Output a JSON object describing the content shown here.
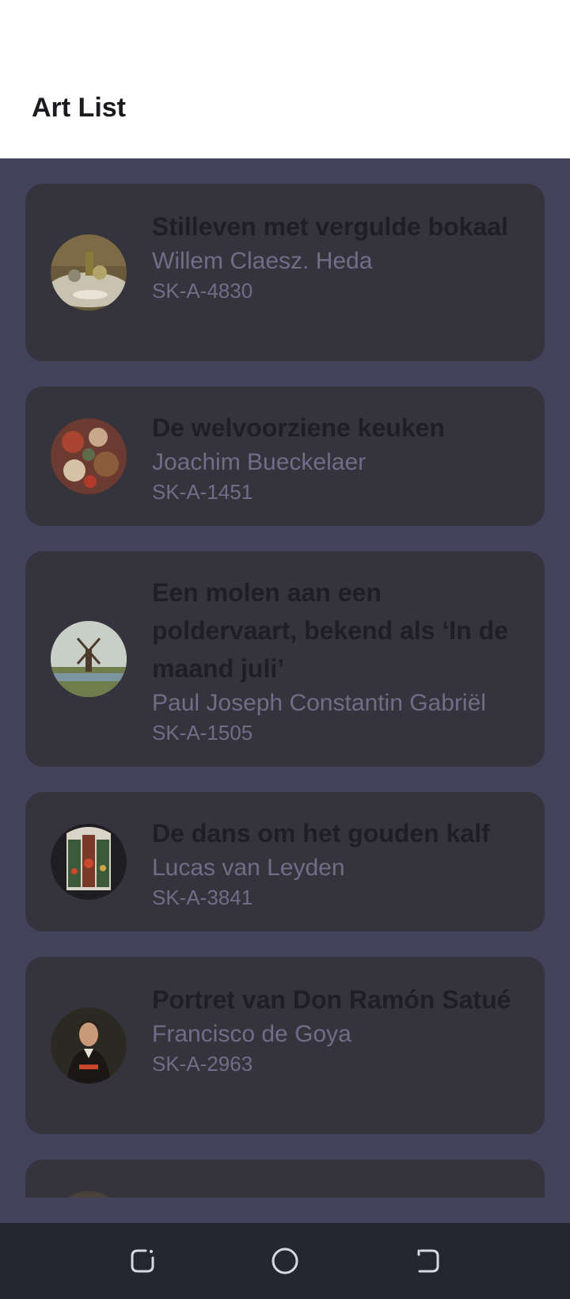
{
  "app_bar": {
    "title": "Art List"
  },
  "artworks": [
    {
      "title": "Stilleven met vergulde bokaal",
      "artist": "Willem Claesz. Heda",
      "id": "SK-A-4830",
      "thumb_icon": "still-life-painting-thumbnail"
    },
    {
      "title": "De welvoorziene keuken",
      "artist": "Joachim Bueckelaer",
      "id": "SK-A-1451",
      "thumb_icon": "kitchen-painting-thumbnail"
    },
    {
      "title": "Een molen aan een poldervaart, bekend als ‘In de maand juli’",
      "artist": "Paul Joseph Constantin Gabriël",
      "id": "SK-A-1505",
      "thumb_icon": "windmill-painting-thumbnail"
    },
    {
      "title": "De dans om het gouden kalf",
      "artist": "Lucas van Leyden",
      "id": "SK-A-3841",
      "thumb_icon": "triptych-painting-thumbnail"
    },
    {
      "title": "Portret van Don Ramón Satué",
      "artist": "Francisco de Goya",
      "id": "SK-A-2963",
      "thumb_icon": "portrait-painting-thumbnail"
    }
  ],
  "nav_bar": {
    "buttons": [
      {
        "icon": "recent-apps-icon"
      },
      {
        "icon": "home-icon"
      },
      {
        "icon": "back-icon"
      }
    ]
  },
  "colors": {
    "app_bar_bg": "#ffffff",
    "list_bg": "#42435a",
    "card_bg": "#35343d",
    "title_text": "#1f1e26",
    "secondary_text": "#6f6d88",
    "nav_bar_bg": "#262633"
  }
}
